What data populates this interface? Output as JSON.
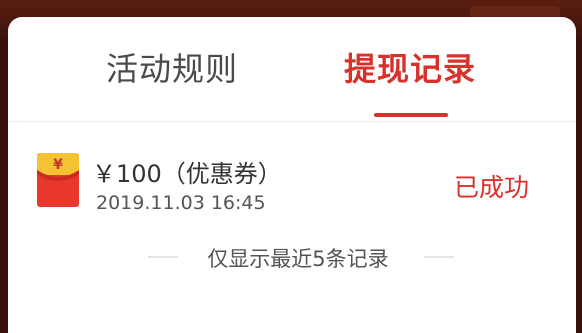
{
  "tabs": [
    {
      "label": "活动规则",
      "active": false
    },
    {
      "label": "提现记录",
      "active": true
    }
  ],
  "records": [
    {
      "icon": "red-envelope-icon",
      "amount": "￥100（优惠券）",
      "time": "2019.11.03 16:45",
      "status": "已成功"
    }
  ],
  "footer": {
    "note": "仅显示最近5条记录"
  },
  "colors": {
    "accent": "#d9322c",
    "envelope_red": "#e8372c",
    "envelope_gold": "#f4c233",
    "background": "#3a120b"
  }
}
